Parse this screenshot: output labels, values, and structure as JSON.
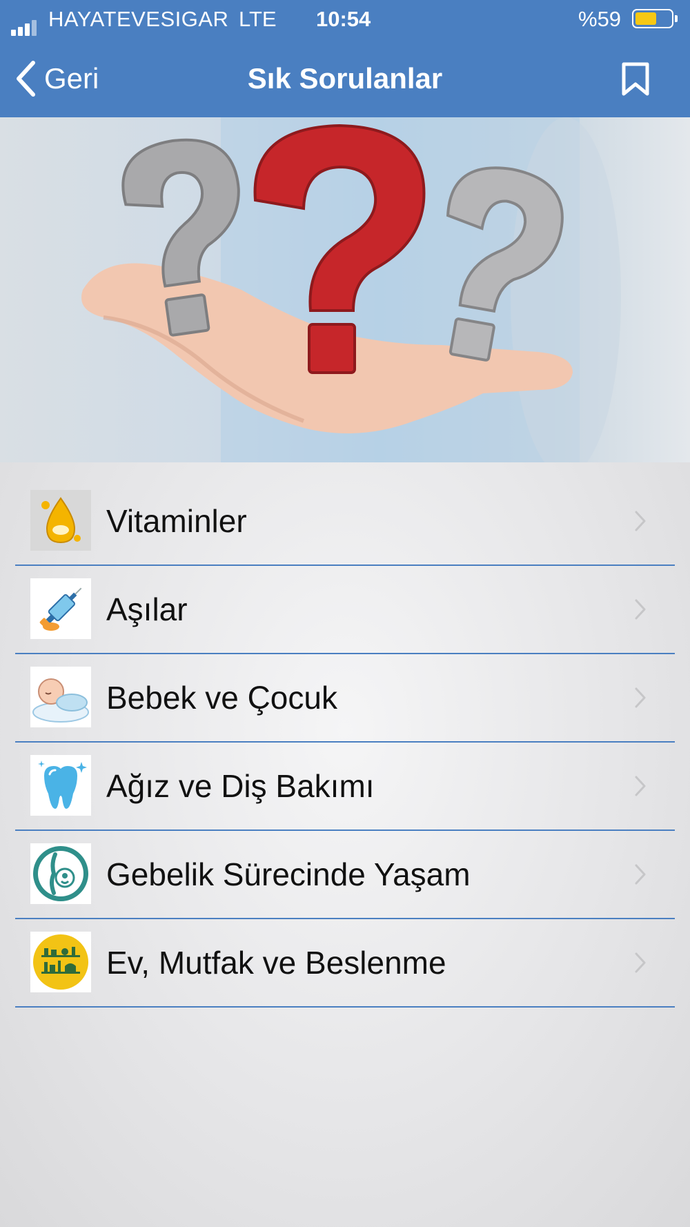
{
  "status_bar": {
    "carrier": "HAYATEVESIGAR",
    "network": "LTE",
    "time": "10:54",
    "battery": "%59",
    "battery_level": 0.59,
    "battery_color": "#f6c814"
  },
  "nav": {
    "back_label": "Geri",
    "title": "Sık Sorulanlar",
    "bookmark_icon": "bookmark-icon",
    "bar_color": "#4a7fc1"
  },
  "hero": {
    "icon": "question-marks-on-hand-image"
  },
  "menu": {
    "items": [
      {
        "label": "Vitaminler",
        "icon": "vitamin-drop-icon"
      },
      {
        "label": "Aşılar",
        "icon": "syringe-icon"
      },
      {
        "label": "Bebek ve Çocuk",
        "icon": "sleeping-baby-icon"
      },
      {
        "label": "Ağız ve Diş Bakımı",
        "icon": "tooth-icon"
      },
      {
        "label": "Gebelik Sürecinde Yaşam",
        "icon": "pregnancy-icon"
      },
      {
        "label": "Ev, Mutfak ve Beslenme",
        "icon": "kitchen-icon"
      }
    ]
  }
}
